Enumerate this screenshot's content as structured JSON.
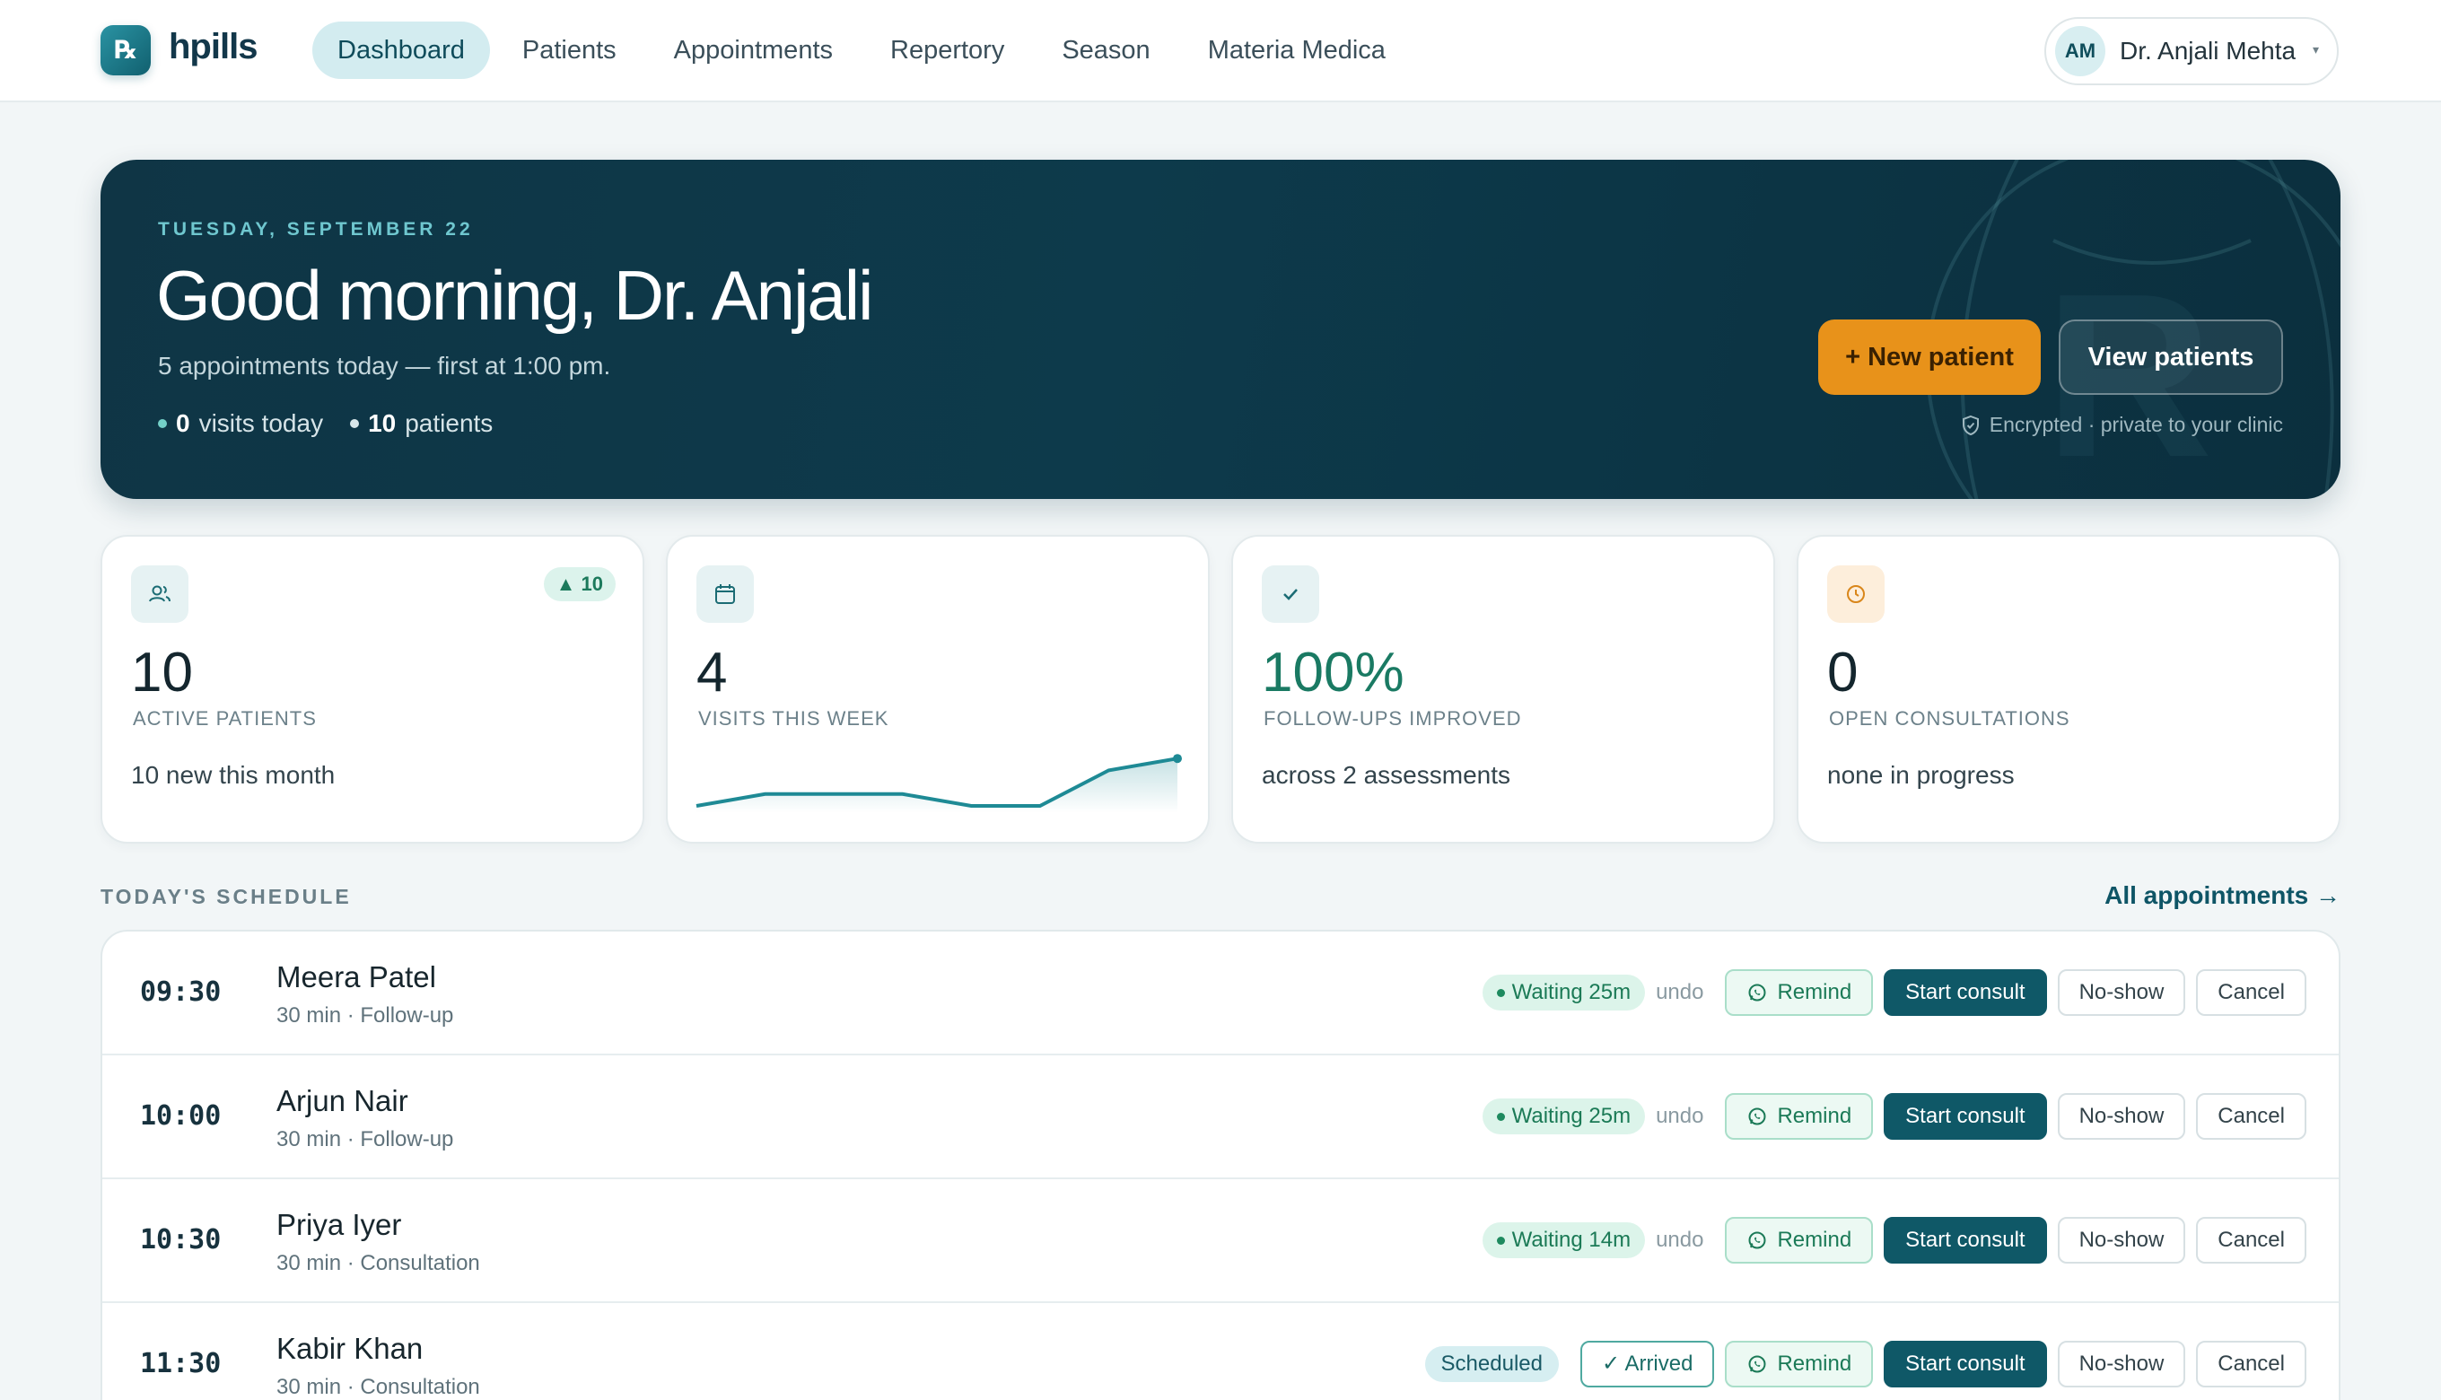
{
  "app": {
    "logo_glyph": "℞",
    "name": "hpills"
  },
  "nav": {
    "items": [
      {
        "label": "Dashboard",
        "active": true
      },
      {
        "label": "Patients",
        "active": false
      },
      {
        "label": "Appointments",
        "active": false
      },
      {
        "label": "Repertory",
        "active": false
      },
      {
        "label": "Season",
        "active": false
      },
      {
        "label": "Materia Medica",
        "active": false
      }
    ]
  },
  "user": {
    "initials": "AM",
    "name": "Dr. Anjali Mehta",
    "caret": "▾"
  },
  "hero": {
    "date": "TUESDAY, SEPTEMBER 22",
    "greeting": "Good morning, Dr. Anjali",
    "subtitle": "5 appointments today — first at 1:00 pm.",
    "visits_value": "0",
    "visits_label": "visits today",
    "patients_value": "10",
    "patients_label": "patients",
    "new_patient_label": "+ New patient",
    "view_patients_label": "View patients",
    "encrypted_note": "Encrypted · private to your clinic"
  },
  "cards": [
    {
      "icon": "users-icon",
      "value": "10",
      "label": "ACTIVE PATIENTS",
      "note": "10 new this month",
      "badge": "▲ 10"
    },
    {
      "icon": "calendar-icon",
      "value": "4",
      "label": "VISITS THIS WEEK"
    },
    {
      "icon": "check-icon",
      "value": "100%",
      "label": "FOLLOW-UPS IMPROVED",
      "note": "across 2 assessments"
    },
    {
      "icon": "clock-icon",
      "value": "0",
      "label": "OPEN CONSULTATIONS",
      "note": "none in progress"
    }
  ],
  "chart_data": {
    "type": "area",
    "title": "",
    "x": [
      1,
      2,
      3,
      4,
      5,
      6,
      7,
      8
    ],
    "values": [
      0,
      1,
      1,
      1,
      0,
      0,
      3,
      4
    ],
    "ylim": [
      0,
      5
    ]
  },
  "schedule": {
    "title": "TODAY'S SCHEDULE",
    "all_link": "All appointments →",
    "rows": [
      {
        "time": "09:30",
        "name": "Meera Patel",
        "meta": "30 min · Follow-up",
        "status": "Waiting 25m",
        "undo": "undo",
        "remind": "Remind",
        "start": "Start consult",
        "noshow": "No-show",
        "cancel": "Cancel"
      },
      {
        "time": "10:00",
        "name": "Arjun Nair",
        "meta": "30 min · Follow-up",
        "status": "Waiting 25m",
        "undo": "undo",
        "remind": "Remind",
        "start": "Start consult",
        "noshow": "No-show",
        "cancel": "Cancel"
      },
      {
        "time": "10:30",
        "name": "Priya Iyer",
        "meta": "30 min · Consultation",
        "status": "Waiting 14m",
        "undo": "undo",
        "remind": "Remind",
        "start": "Start consult",
        "noshow": "No-show",
        "cancel": "Cancel"
      },
      {
        "time": "11:30",
        "name": "Kabir Khan",
        "meta": "30 min · Consultation",
        "status": "Scheduled",
        "arrived": "✓ Arrived",
        "remind": "Remind",
        "start": "Start consult",
        "noshow": "No-show",
        "cancel": "Cancel"
      }
    ]
  },
  "colors": {
    "accent": "#0f5867",
    "hero_bg": "#0d3a4b",
    "orange": "#e8921a",
    "wait_green": "#1b7a56"
  }
}
